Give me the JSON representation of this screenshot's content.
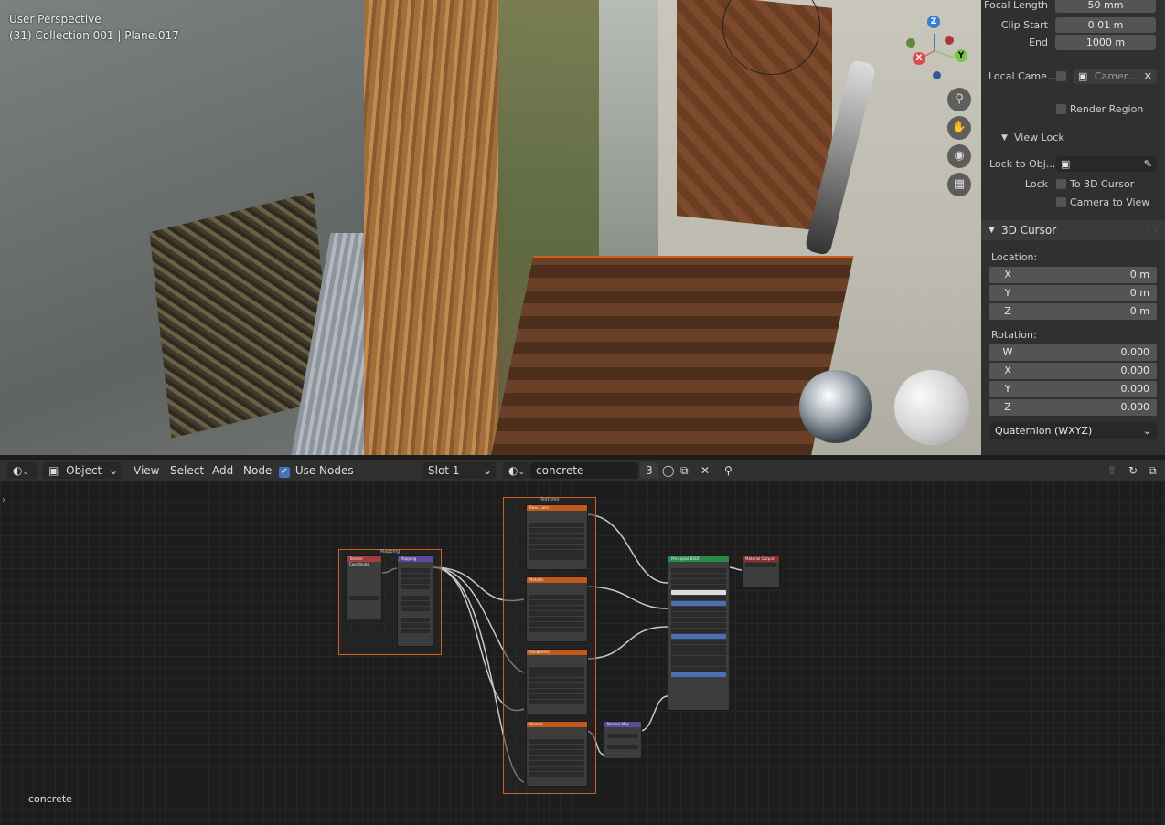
{
  "viewport": {
    "mode": "User Perspective",
    "context": "(31) Collection.001 | Plane.017",
    "gizmo": {
      "x": "X",
      "y": "Y",
      "z": "Z"
    }
  },
  "properties": {
    "focal_length_label": "Focal Length",
    "focal_length": "50 mm",
    "clip_start_label": "Clip Start",
    "clip_start": "0.01 m",
    "end_label": "End",
    "end": "1000 m",
    "local_camera_label": "Local Came...",
    "local_camera_value": "Camer...",
    "render_region": "Render Region",
    "view_lock": "View Lock",
    "lock_to_obj_label": "Lock to Obj...",
    "lock_label": "Lock",
    "to_3d_cursor": "To 3D Cursor",
    "camera_to_view": "Camera to View",
    "cursor_section": "3D Cursor",
    "location_label": "Location:",
    "location": [
      {
        "axis": "X",
        "value": "0 m"
      },
      {
        "axis": "Y",
        "value": "0 m"
      },
      {
        "axis": "Z",
        "value": "0 m"
      }
    ],
    "rotation_label": "Rotation:",
    "rotation": [
      {
        "axis": "W",
        "value": "0.000"
      },
      {
        "axis": "X",
        "value": "0.000"
      },
      {
        "axis": "Y",
        "value": "0.000"
      },
      {
        "axis": "Z",
        "value": "0.000"
      }
    ],
    "rotation_mode": "Quaternion (WXYZ)"
  },
  "node_header": {
    "mode": "Object",
    "menu": [
      "View",
      "Select",
      "Add",
      "Node"
    ],
    "use_nodes": "Use Nodes",
    "slot": "Slot 1",
    "material": "concrete",
    "users": "3"
  },
  "node_editor": {
    "material_label": "concrete",
    "frames": {
      "mapping": "Mapping",
      "textures": "Textures"
    },
    "nodes": {
      "tex_coord": "Texture Coordinate",
      "mapping": "Mapping",
      "base_color": "Base Color",
      "metallic": "Metallic",
      "roughness": "Roughness",
      "normal": "Normal",
      "normal_map": "Normal Map",
      "principled": "Principled BSDF",
      "output": "Material Output"
    }
  },
  "colors": {
    "accent_orange": "#d2601f",
    "texture_node_header": "#c25a1c",
    "shader_header": "#2b8a4a",
    "output_header": "#8a2d2d",
    "vector_header": "#5b4a9a"
  }
}
